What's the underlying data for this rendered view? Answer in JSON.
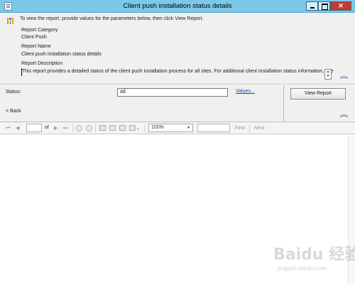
{
  "window": {
    "title": "Client push installation status details"
  },
  "info": {
    "prompt": "To view the report, provide values for the parameters below, then click View Report.",
    "category_label": "Report Category",
    "category_value": "Client Push",
    "name_label": "Report Name",
    "name_value": "Client push installation status details",
    "description_label": "Report Description",
    "description_value": "This report provides a detailed status of the client push installation process for all sites. For additional client installation status information, see"
  },
  "parameters": {
    "status_label": "Status:",
    "status_value": "All",
    "values_link": "Values...",
    "view_report_button": "View Report",
    "back_link": "< Back"
  },
  "toolbar": {
    "of_label": "of",
    "page_value": "",
    "zoom_value": "100%",
    "find_label": "Find",
    "next_label": "Next"
  },
  "watermark": {
    "logo_text": "Baidu 经验",
    "url_text": "jingyan.baidu.com"
  },
  "colors": {
    "titlebar": "#7bc8e8",
    "close_button": "#c7392b",
    "panel_background": "#f0f0f0",
    "link": "#1c3fb8"
  }
}
